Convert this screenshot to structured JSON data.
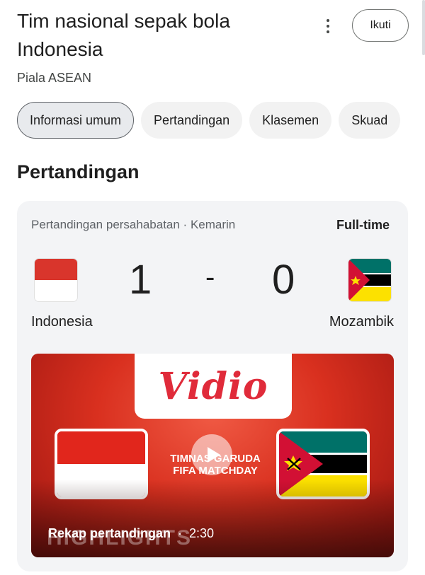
{
  "header": {
    "title": "Tim nasional sepak bola Indonesia",
    "subtitle": "Piala ASEAN",
    "follow_label": "Ikuti",
    "more_icon": "more-vert-icon"
  },
  "tabs": [
    {
      "label": "Informasi umum",
      "active": true
    },
    {
      "label": "Pertandingan",
      "active": false
    },
    {
      "label": "Klasemen",
      "active": false
    },
    {
      "label": "Skuad",
      "active": false
    }
  ],
  "section": {
    "title": "Pertandingan"
  },
  "match": {
    "meta": "Pertandingan persahabatan · Kemarin",
    "status": "Full-time",
    "home": {
      "name": "Indonesia",
      "score": "1",
      "flag_colors": [
        "#d9352c",
        "#ffffff"
      ]
    },
    "separator": "-",
    "away": {
      "name": "Mozambik",
      "score": "0",
      "flag_colors": [
        "#007168",
        "#000000",
        "#fce100",
        "#d21034",
        "#ffffff"
      ]
    }
  },
  "video": {
    "brand": "Vidio",
    "overlay_text": "TIMNAS GARUDA FIFA MATCHDAY",
    "watermark": "HIGHLIGHTS",
    "caption": "Rekap pertandingan",
    "separator": "·",
    "duration": "2:30",
    "brand_color": "#e02b3a",
    "background_color": "#d9301f"
  }
}
